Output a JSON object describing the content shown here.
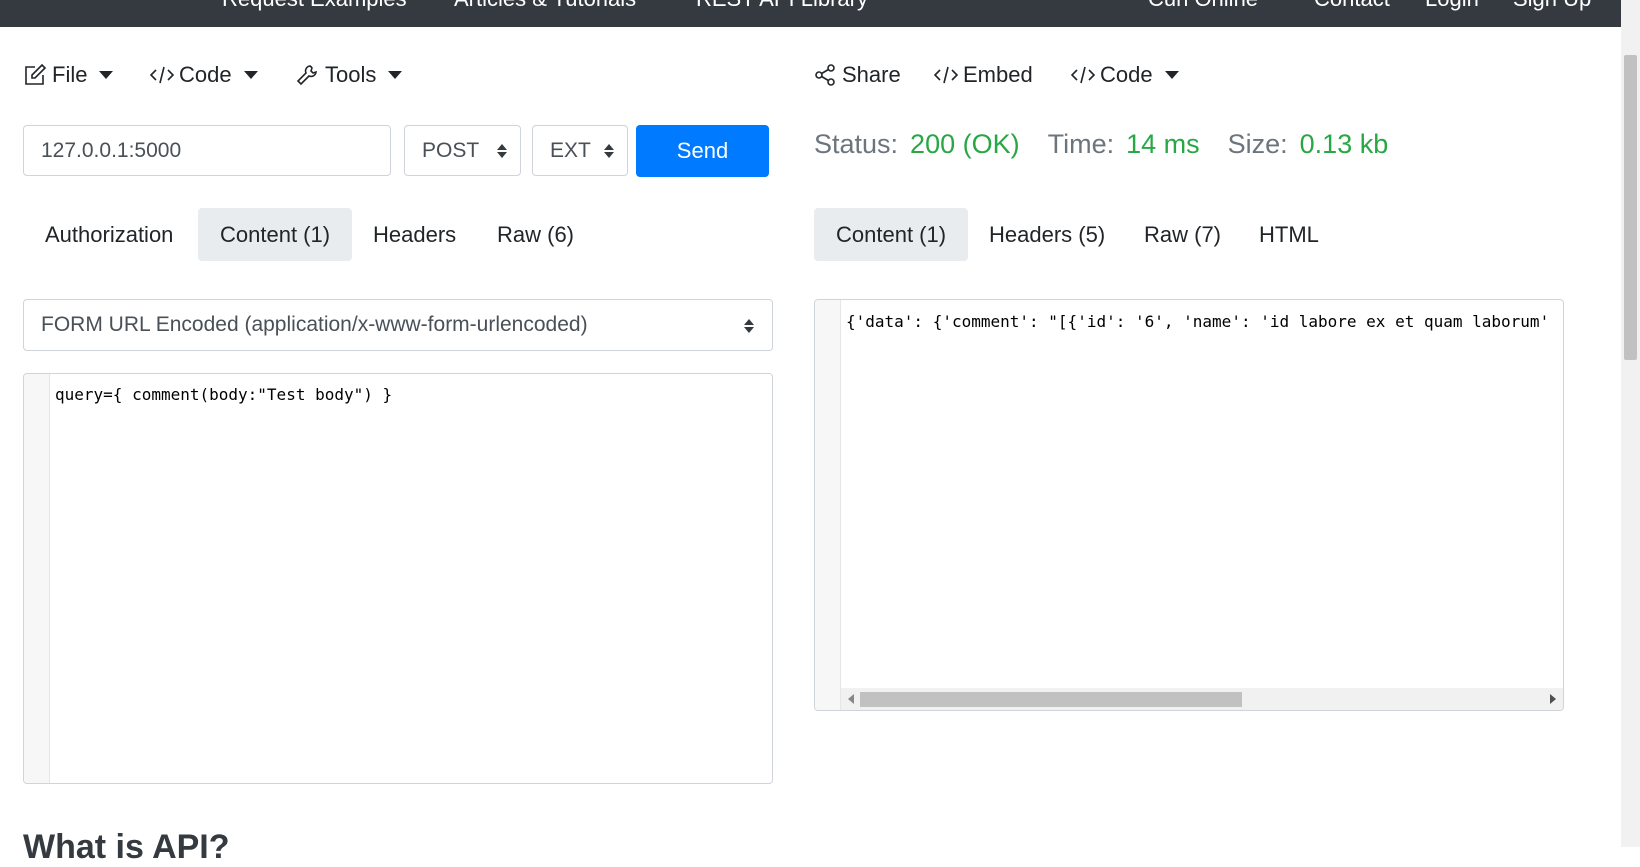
{
  "topnav": {
    "left": [
      "Request Examples",
      "Articles & Tutorials",
      "REST API Library"
    ],
    "right": [
      "Curl Online",
      "Contact",
      "Login",
      "Sign Up"
    ]
  },
  "request_menu": {
    "file": "File",
    "code": "Code",
    "tools": "Tools"
  },
  "response_menu": {
    "share": "Share",
    "embed": "Embed",
    "code": "Code"
  },
  "request": {
    "url": "127.0.0.1:5000",
    "method": "POST",
    "mode": "EXT",
    "send_label": "Send"
  },
  "request_tabs": [
    {
      "label": "Authorization",
      "active": false
    },
    {
      "label": "Content (1)",
      "active": true
    },
    {
      "label": "Headers",
      "active": false
    },
    {
      "label": "Raw (6)",
      "active": false
    }
  ],
  "content_type": "FORM URL Encoded (application/x-www-form-urlencoded)",
  "request_body": "query={ comment(body:\"Test body\") }",
  "response": {
    "status_label": "Status:",
    "status_value": "200 (OK)",
    "time_label": "Time:",
    "time_value": "14 ms",
    "size_label": "Size:",
    "size_value": "0.13 kb",
    "body": "{'data': {'comment': \"[{'id': '6', 'name': 'id labore ex et quam laborum'"
  },
  "response_tabs": [
    {
      "label": "Content (1)",
      "active": true
    },
    {
      "label": "Headers (5)",
      "active": false
    },
    {
      "label": "Raw (7)",
      "active": false
    },
    {
      "label": "HTML",
      "active": false
    }
  ],
  "bottom_heading": "What is API?",
  "colors": {
    "navbar": "#343a40",
    "primary": "#007bff",
    "success": "#28a745",
    "muted": "#6c757d",
    "tab_active_bg": "#e9ecef"
  }
}
